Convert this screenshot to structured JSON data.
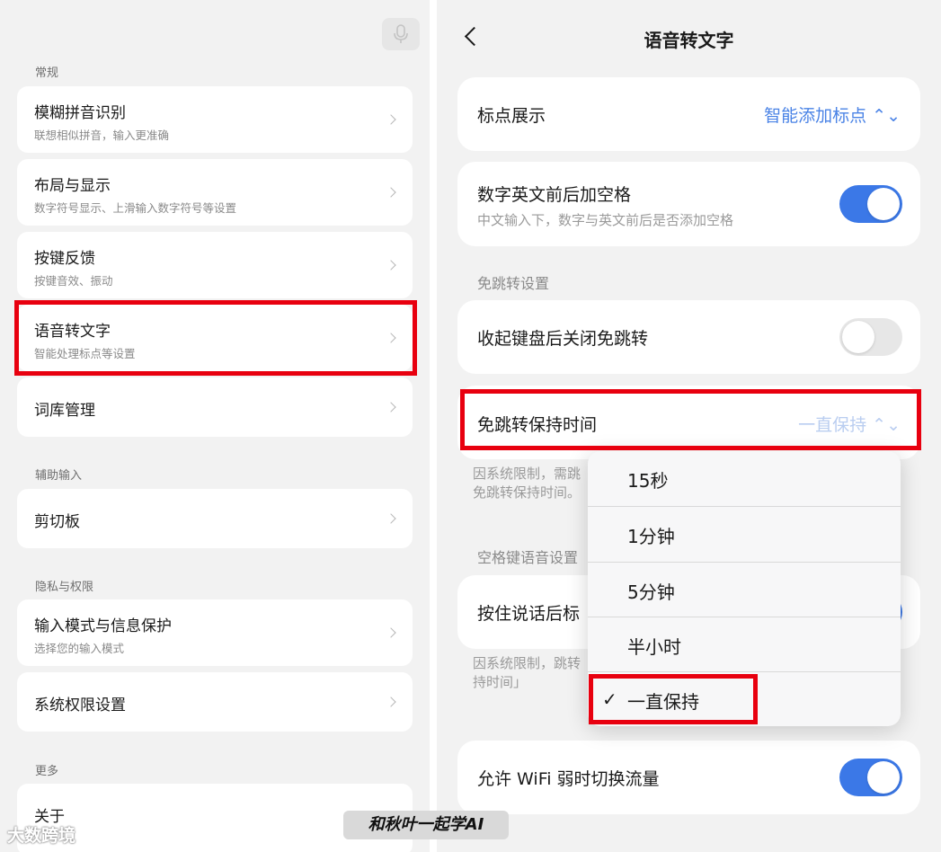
{
  "left": {
    "sections": {
      "general": "常规",
      "assist": "辅助输入",
      "privacy": "隐私与权限",
      "more": "更多"
    },
    "items": [
      {
        "title": "模糊拼音识别",
        "sub": "联想相似拼音，输入更准确"
      },
      {
        "title": "布局与显示",
        "sub": "数字符号显示、上滑输入数字符号等设置"
      },
      {
        "title": "按键反馈",
        "sub": "按键音效、振动"
      },
      {
        "title": "语音转文字",
        "sub": "智能处理标点等设置"
      },
      {
        "title": "词库管理"
      },
      {
        "title": "剪切板"
      },
      {
        "title": "输入模式与信息保护",
        "sub": "选择您的输入模式"
      },
      {
        "title": "系统权限设置"
      },
      {
        "title": "关于"
      }
    ]
  },
  "right": {
    "title": "语音转文字",
    "punctuation": {
      "label": "标点展示",
      "value": "智能添加标点 ⌃⌄"
    },
    "spacing": {
      "label": "数字英文前后加空格",
      "sub": "中文输入下，数字与英文前后是否添加空格",
      "on": true
    },
    "no_jump_section": "免跳转设置",
    "close_no_jump": {
      "label": "收起键盘后关闭免跳转",
      "on": false
    },
    "keep_time": {
      "label": "免跳转保持时间",
      "value": "一直保持 ⌃⌄"
    },
    "note1": "因系统限制，需跳转……免跳转保持时间。",
    "note1_line1": "因系统限制，需跳",
    "note1_line2": "免跳转保持时间。",
    "space_section": "空格键语音设置",
    "hold_talk": {
      "label": "按住说话后标",
      "on": true
    },
    "note2_line1": "因系统限制，跳转",
    "note2_line2": "持时间」",
    "wifi": {
      "label": "允许 WiFi 弱时切换流量",
      "on": true
    }
  },
  "dropdown": {
    "options": [
      "15秒",
      "1分钟",
      "5分钟",
      "半小时",
      "一直保持"
    ],
    "selected": "一直保持",
    "check": "✓"
  },
  "watermarks": {
    "left": "大数跨境",
    "center": "和秋叶一起学AI"
  }
}
